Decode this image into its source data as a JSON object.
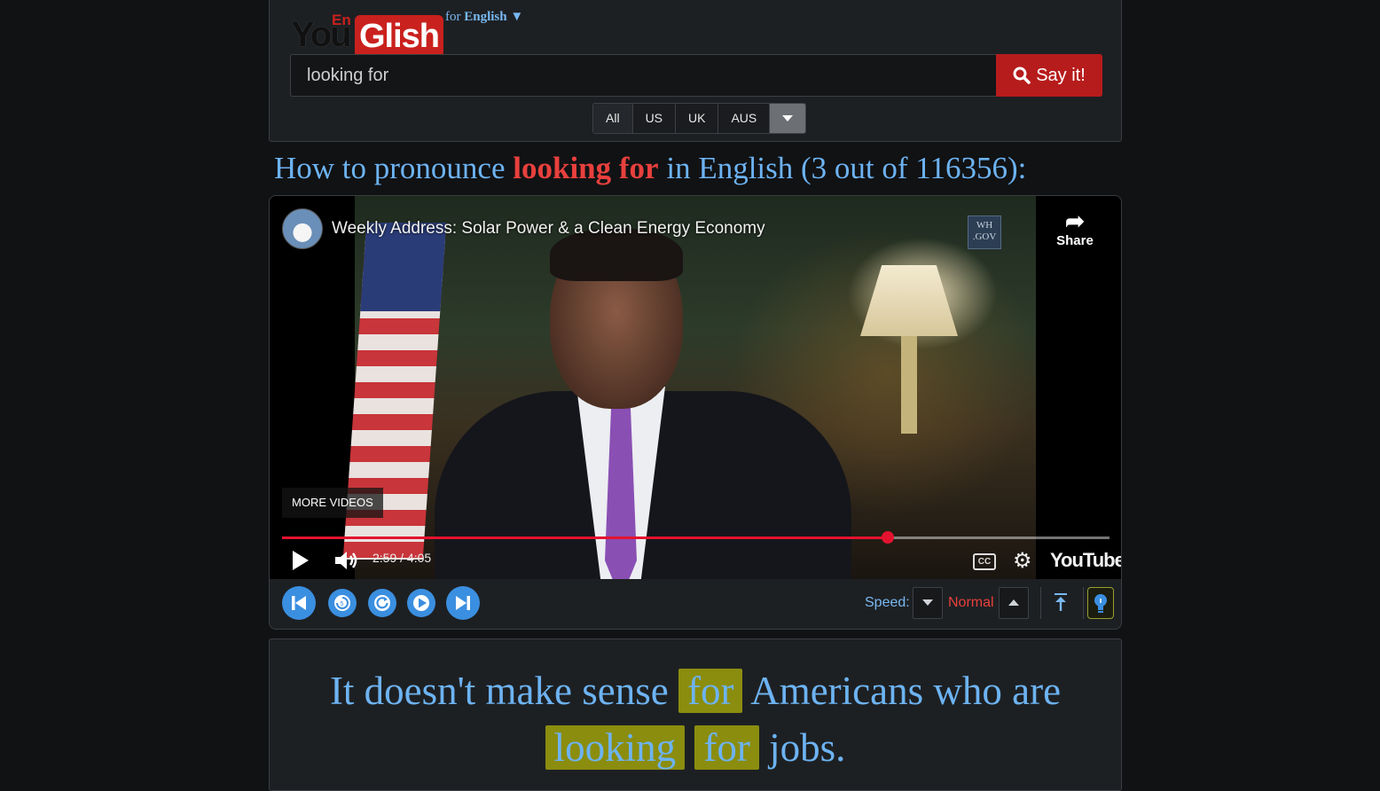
{
  "logo": {
    "you": "You",
    "en": "En",
    "glish": "Glish"
  },
  "language": {
    "prefix": "for",
    "name": "English",
    "arrow": "▼"
  },
  "search": {
    "value": "looking for",
    "button_label": "Say it!"
  },
  "accents": [
    "All",
    "US",
    "UK",
    "AUS"
  ],
  "headline": {
    "prefix": "How to pronounce",
    "term": "looking for",
    "suffix": "in English (3 out of 116356):"
  },
  "video": {
    "title": "Weekly Address: Solar Power & a Clean Energy Economy",
    "badge": "WH .GOV",
    "share_label": "Share",
    "more_videos_label": "MORE VIDEOS",
    "current_time": "2:59",
    "total_time": "4:05",
    "progress": 0.732,
    "cc_label": "CC",
    "brand": "YouTube"
  },
  "toolbar": {
    "speed_label": "Speed:",
    "speed_value": "Normal"
  },
  "caption": {
    "parts": [
      {
        "text": "It doesn't make sense ",
        "highlight": false
      },
      {
        "text": "for",
        "highlight": true
      },
      {
        "text": " Americans who are ",
        "highlight": false
      },
      {
        "text": "looking",
        "highlight": true
      },
      {
        "text": " ",
        "highlight": false
      },
      {
        "text": "for",
        "highlight": true
      },
      {
        "text": " jobs.",
        "highlight": false
      }
    ]
  },
  "colors": {
    "accent_blue": "#6db3f2",
    "accent_red": "#e8403d",
    "say_button": "#b71c1c",
    "highlight": "#8b8d0f",
    "progress": "#e3132f"
  },
  "icons": {
    "search": "search-icon",
    "share": "share-arrow-icon",
    "play": "play-icon",
    "volume": "volume-icon",
    "settings": "gear-icon",
    "previous": "skip-previous-icon",
    "replay5": "replay-5-icon",
    "replay": "replay-icon",
    "play_small": "play-circle-icon",
    "next": "skip-next-icon",
    "top": "arrow-to-top-icon",
    "tip": "lightbulb-icon"
  }
}
